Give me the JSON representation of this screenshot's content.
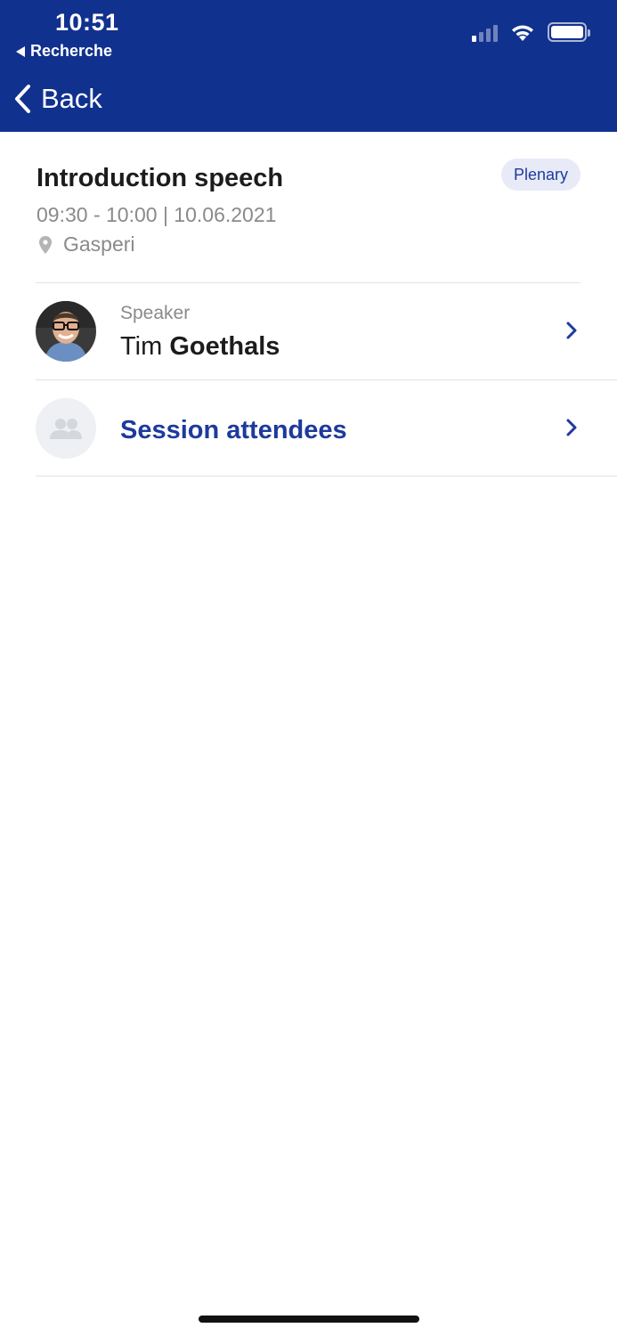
{
  "status_bar": {
    "time": "10:51",
    "back_app_label": "Recherche"
  },
  "nav": {
    "back_label": "Back"
  },
  "session": {
    "title": "Introduction speech",
    "tag": "Plenary",
    "time_range": "09:30 - 10:00 | 10.06.2021",
    "location": "Gasperi"
  },
  "speaker_row": {
    "label": "Speaker",
    "first_name": "Tim",
    "last_name": "Goethals"
  },
  "attendees_row": {
    "label": "Session attendees"
  },
  "colors": {
    "header_bg": "#11318f",
    "accent": "#1d3a9c",
    "tag_bg": "#e8ebf7",
    "muted_text": "#8a8a8a"
  },
  "icons": {
    "back": "chevron-left-icon",
    "location": "map-pin-icon",
    "row_chevron": "chevron-right-icon",
    "attendees": "people-icon"
  }
}
